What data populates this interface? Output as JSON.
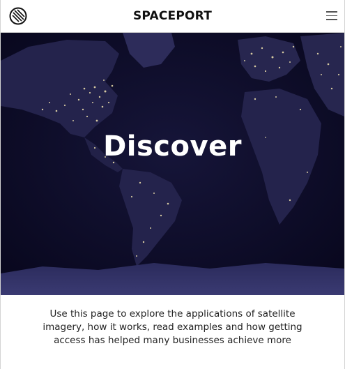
{
  "header": {
    "brand": "SPACEPORT",
    "logo_icon": "satellite-logo-icon",
    "menu_icon": "hamburger-menu-icon"
  },
  "hero": {
    "title": "Discover",
    "image": "night-earth-city-lights"
  },
  "intro": {
    "text": "Use this page to explore the applications of satellite imagery, how it works, read examples and how getting access has helped many businesses achieve more"
  },
  "colors": {
    "hero_background": "#0d0c2b",
    "landmass": "#2a2a55",
    "city_lights": "#f4e6b0"
  }
}
